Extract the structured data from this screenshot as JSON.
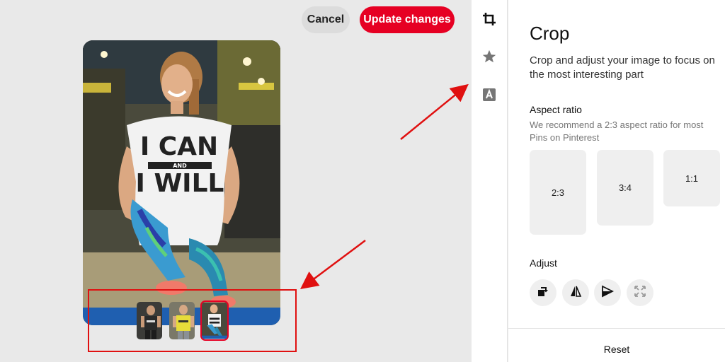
{
  "toolbar": {
    "cancel_label": "Cancel",
    "update_label": "Update changes"
  },
  "thumbnails": [
    {
      "name": "thumb-1",
      "selected": false
    },
    {
      "name": "thumb-2",
      "selected": false
    },
    {
      "name": "thumb-3",
      "selected": true
    }
  ],
  "photo": {
    "shirt_line1": "I CAN",
    "shirt_and": "AND",
    "shirt_line2": "I WILL"
  },
  "strip": {
    "icons": [
      "crop-icon",
      "star-icon",
      "text-icon"
    ]
  },
  "panel": {
    "title": "Crop",
    "description": "Crop and adjust your image to focus on the most interesting part",
    "aspect_title": "Aspect ratio",
    "aspect_hint": "We recommend a 2:3 aspect ratio for most Pins on Pinterest",
    "ratios": [
      "2:3",
      "3:4",
      "1:1"
    ],
    "adjust_title": "Adjust",
    "adjust_icons": [
      "rotate-icon",
      "flip-horizontal-icon",
      "flip-vertical-icon",
      "expand-icon"
    ],
    "reset_label": "Reset"
  },
  "colors": {
    "accent": "#e60023",
    "annotation": "#e01010"
  }
}
